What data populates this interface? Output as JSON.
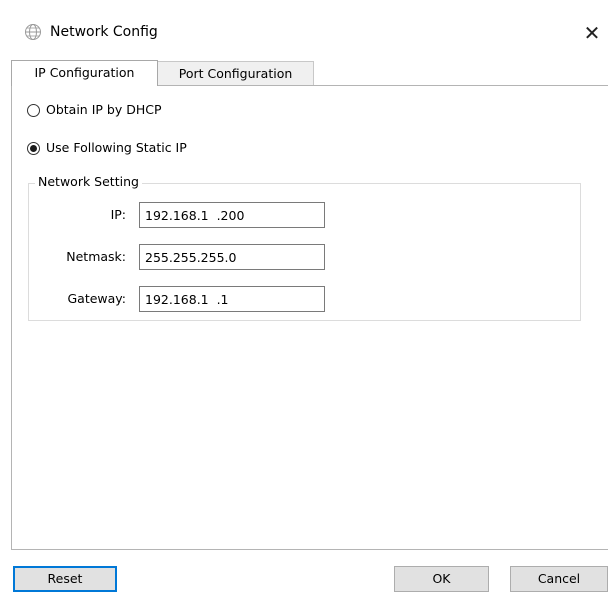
{
  "window": {
    "title": "Network Config",
    "icon": "globe-icon",
    "close_glyph": "✕"
  },
  "tabs": [
    {
      "label": "IP Configuration",
      "active": true
    },
    {
      "label": "Port Configuration",
      "active": false
    }
  ],
  "ip_mode": {
    "dhcp_label": "Obtain IP by DHCP",
    "static_label": "Use Following Static IP",
    "selected": "static"
  },
  "network_setting": {
    "legend": "Network Setting",
    "fields": [
      {
        "label": "IP:",
        "value": "192.168.1  .200"
      },
      {
        "label": "Netmask:",
        "value": "255.255.255.0"
      },
      {
        "label": "Gateway:",
        "value": "192.168.1  .1"
      }
    ]
  },
  "buttons": {
    "reset": "Reset",
    "ok": "OK",
    "cancel": "Cancel"
  },
  "colors": {
    "focus_border": "#0078d7",
    "button_face": "#e1e1e1"
  }
}
